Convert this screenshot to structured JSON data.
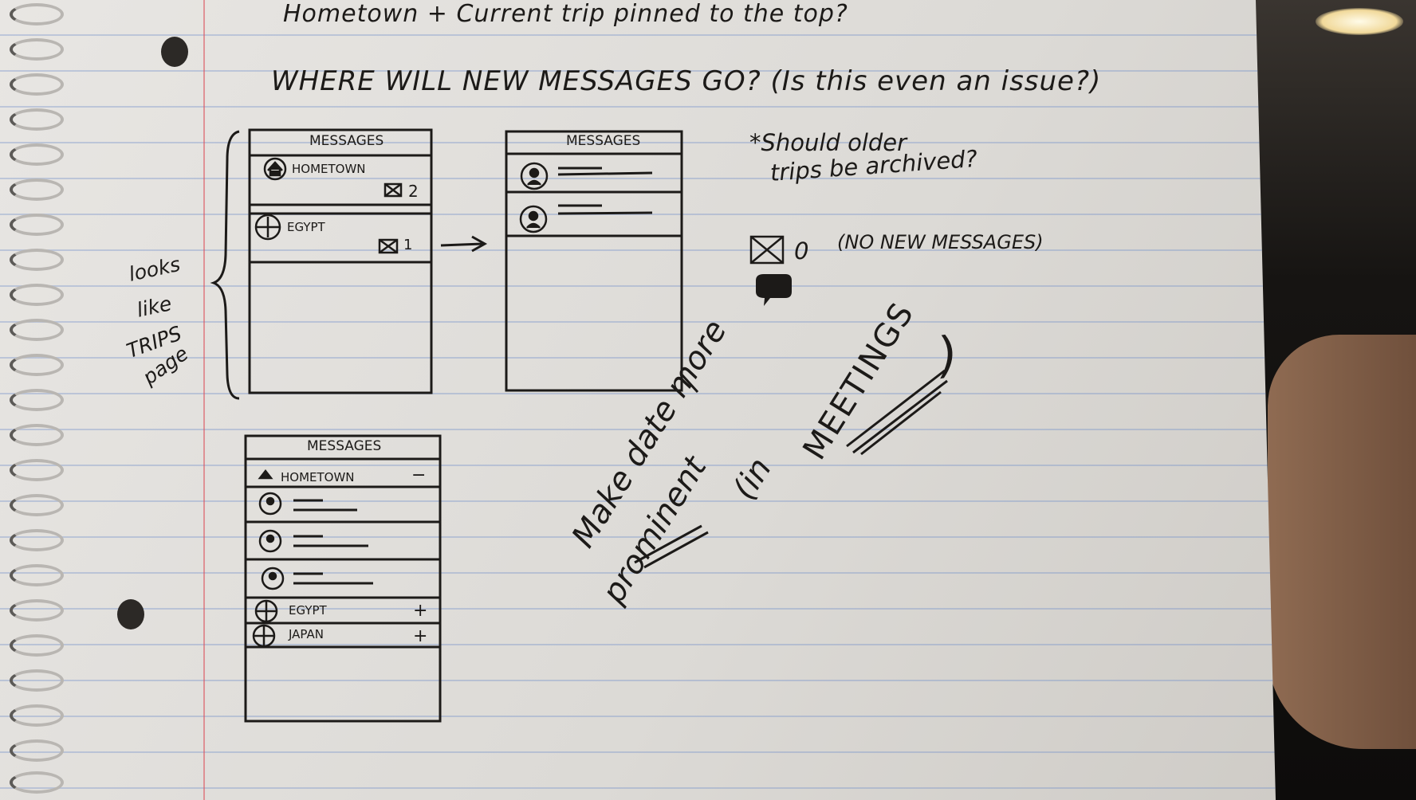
{
  "notes": {
    "top_line": "Hometown + Current trip pinned to the top?",
    "question": "WHERE WILL NEW MESSAGES GO? (Is this even an issue?)",
    "archive_note_line1": "*Should older",
    "archive_note_line2": "trips be archived?",
    "no_new_count": "0",
    "no_new_label": "(NO NEW MESSAGES)",
    "side_note": [
      "looks",
      "like",
      "TRIPS",
      "page"
    ],
    "date_note_line1": "Make date more",
    "date_note_line2_a": "prominent",
    "date_note_line2_b": "(in",
    "date_note_meetings": "MEETINGS",
    "date_note_close": ")"
  },
  "sketch_a": {
    "title": "MESSAGES",
    "rows": [
      {
        "label": "HOMETOWN",
        "count": "2"
      },
      {
        "label": "EGYPT",
        "count": "1"
      }
    ]
  },
  "sketch_b": {
    "title": "MESSAGES"
  },
  "sketch_c": {
    "title": "MESSAGES",
    "header_row": "HOMETOWN",
    "header_toggle": "−",
    "trip_rows": [
      {
        "label": "EGYPT",
        "toggle": "+"
      },
      {
        "label": "JAPAN",
        "toggle": "+"
      }
    ]
  },
  "icons": [
    "house-icon",
    "plane-icon",
    "mail-icon",
    "person-icon",
    "chat-bubble-icon",
    "arrow-right-icon"
  ]
}
